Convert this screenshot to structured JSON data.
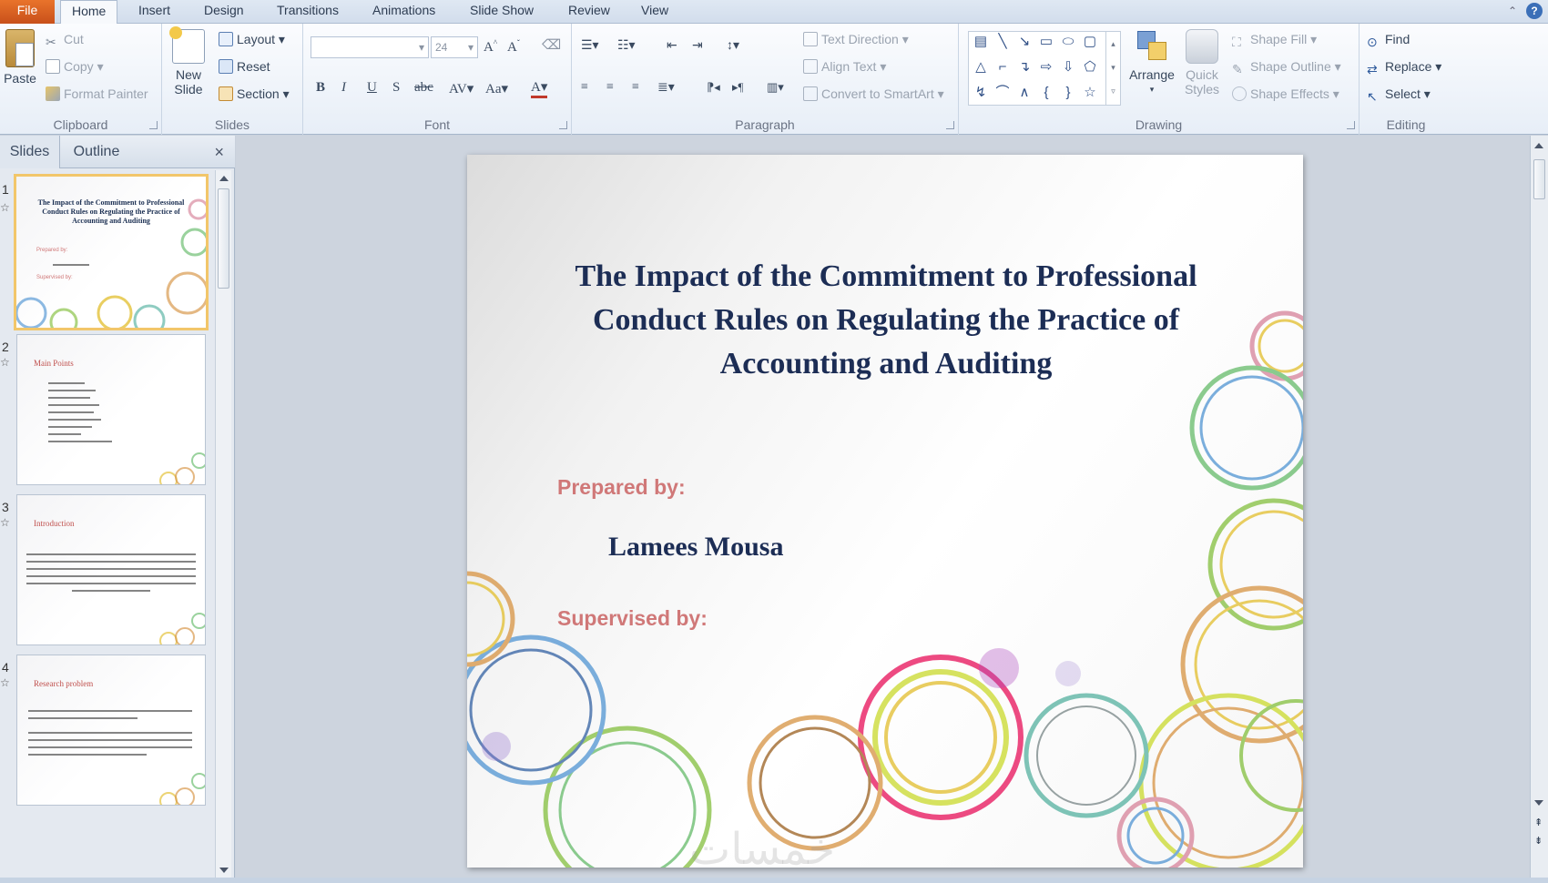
{
  "tabs": [
    "File",
    "Home",
    "Insert",
    "Design",
    "Transitions",
    "Animations",
    "Slide Show",
    "Review",
    "View"
  ],
  "active_tab": "Home",
  "ribbon": {
    "clipboard": {
      "label": "Clipboard",
      "paste": "Paste",
      "cut": "Cut",
      "copy": "Copy",
      "format_painter": "Format Painter"
    },
    "slides": {
      "label": "Slides",
      "new_slide_1": "New",
      "new_slide_2": "Slide",
      "layout": "Layout",
      "reset": "Reset",
      "section": "Section"
    },
    "font": {
      "label": "Font",
      "font_size": "24"
    },
    "paragraph": {
      "label": "Paragraph",
      "text_direction": "Text Direction",
      "align_text": "Align Text",
      "convert_smartart": "Convert to SmartArt"
    },
    "drawing": {
      "label": "Drawing",
      "arrange": "Arrange",
      "quick_styles_1": "Quick",
      "quick_styles_2": "Styles",
      "shape_fill": "Shape Fill",
      "shape_outline": "Shape Outline",
      "shape_effects": "Shape Effects"
    },
    "editing": {
      "label": "Editing",
      "find": "Find",
      "replace": "Replace",
      "select": "Select"
    }
  },
  "pane": {
    "tab_slides": "Slides",
    "tab_outline": "Outline",
    "close": "×",
    "slide_numbers": [
      "1",
      "2",
      "3",
      "4"
    ],
    "thumb_2_head": "Main Points",
    "thumb_3_head": "Introduction",
    "thumb_4_head": "Research problem"
  },
  "slide": {
    "title_line_1": "The Impact of the Commitment to Professional",
    "title_line_2": "Conduct Rules on Regulating the Practice of",
    "title_line_3": "Accounting and Auditing",
    "prepared_by": "Prepared by:",
    "author": "Lamees Mousa",
    "supervised_by": "Supervised by:"
  },
  "watermark": "خمسات",
  "colors": {
    "accent_file": "#d7622a",
    "title": "#1c2d55",
    "label": "#d07878",
    "selection": "#f2c66a"
  }
}
